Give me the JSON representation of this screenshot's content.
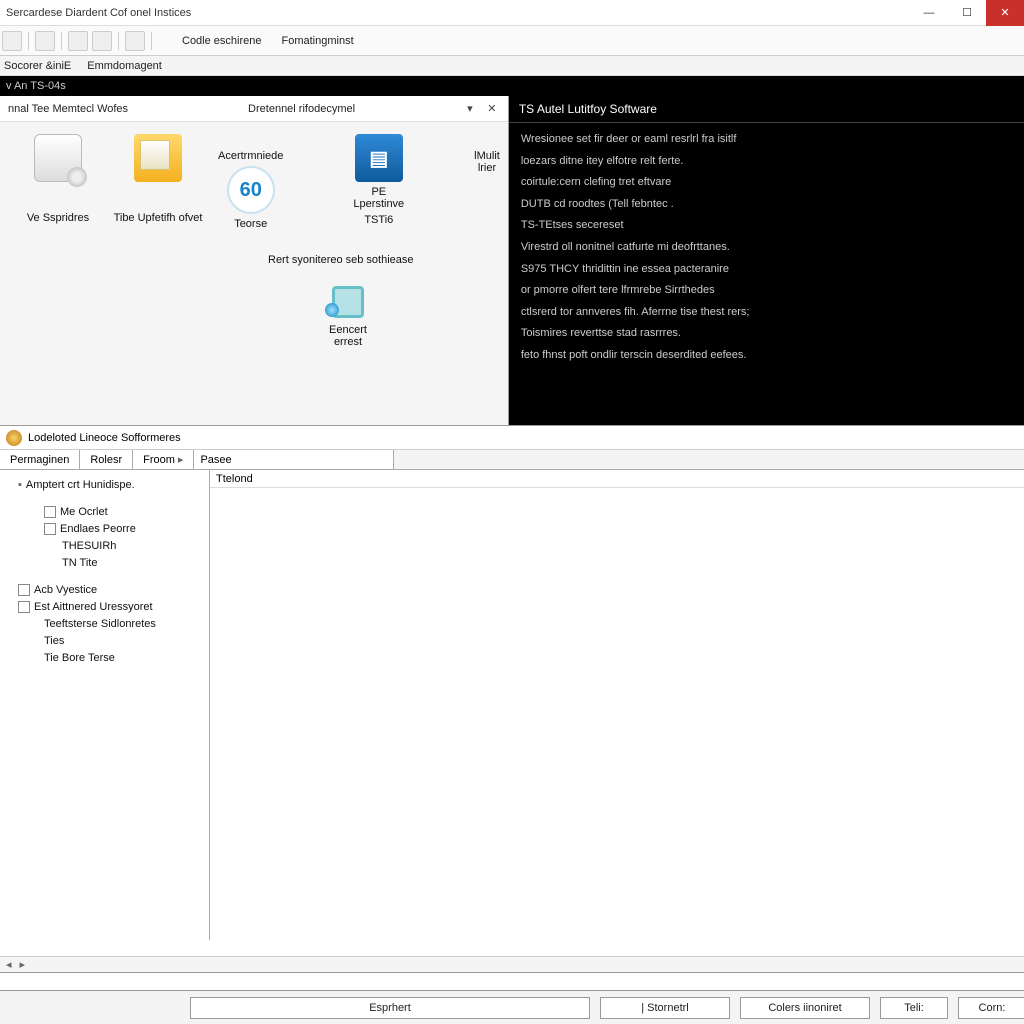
{
  "window": {
    "title": "Sercardese Diardent Cof onel Instices"
  },
  "toolbar": {
    "item1": "Codle eschirene",
    "item2": "Fomatingminst"
  },
  "menubar": {
    "m1": "Socorer &iniE",
    "m2": "Emmdomagent"
  },
  "tabstrip": {
    "t1": "v An TS-04s"
  },
  "leftpanel": {
    "title": "nnal Tee Memtecl Wofes",
    "subtitle": "Dretennel rifodecymel",
    "icons": {
      "disc": "Ve Sspridres",
      "folder": "Tibe Upfetifh ofvet",
      "sixty_label": "Teorse",
      "acrt": "Acertrmniede",
      "tile_l1": "PE Lperstinve",
      "tile_l2": "TSTi6",
      "mult": "lMulit lrier",
      "mid": "Rert syonitereo seb sothiease",
      "pc": "Eencert errest"
    }
  },
  "rightpanel": {
    "title": "TS Autel Lutitfoy Software",
    "lines": [
      "Wresionee set fir deer or eaml resrlrl fra isitlf",
      "loezars ditne itey elfotre relt ferte.",
      "coirtule:cern clefing tret eftvare",
      "",
      "DUTB cd roodtes (Tell febntec .",
      "TS-TEtses secereset",
      "Virestrd oll nonitnel catfurte mi deofrttanes.",
      "S975 THCY thridittin ine essea pacteranire",
      "or pmorre olfert tere lfrmrebe Sirrthedes",
      "ctlsrerd tor annveres fih. Aferrne tise thest rers;",
      "Toismires reverttse stad rasrrres.",
      "feto fhnst poft ondlir terscin deserdited eefees."
    ]
  },
  "bottom": {
    "title": "Lodeloted Lineoce Sofformeres",
    "tabs": {
      "t1": "Permaginen",
      "t2": "Rolesr",
      "t3": "Froom",
      "t4": "Pasee"
    },
    "tablecell": "Ttelond",
    "tree": {
      "root": "Amptert crt Hunidispe.",
      "n1": "Me Ocrlet",
      "n2": "Endlaes Peorre",
      "n2a": "THESUIRh",
      "n2b": "TN Tite",
      "n3": "Acb Vyestice",
      "n4": "Est Aittnered Uressyoret",
      "n4a": "Teeftsterse Sidlonretes",
      "n4b": "Ties",
      "n4c": "Tie Bore Terse"
    }
  },
  "footer": {
    "b1": "Esprhert",
    "b2": "| Stornetrl",
    "b3": "Colers iinoniret",
    "b4": "Teli:",
    "b5": "Corn:"
  }
}
